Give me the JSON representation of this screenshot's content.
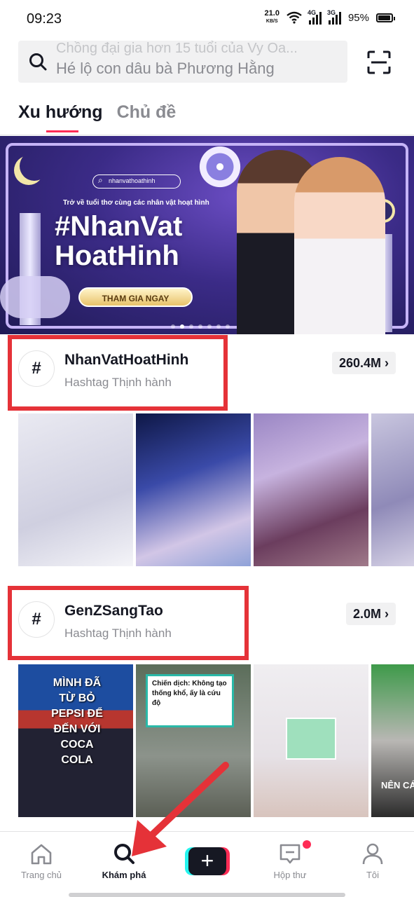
{
  "status_bar": {
    "time": "09:23",
    "net_speed": "21.0",
    "net_unit": "KB/S",
    "sim1": "4G",
    "sim2": "3G",
    "battery": "95%"
  },
  "search": {
    "ghost_suggestion": "Chồng đại gia hơn 15 tuổi của Vy Oa...",
    "placeholder": "Hé lộ con dâu bà Phương Hằng"
  },
  "tabs": [
    {
      "label": "Xu hướng",
      "active": true
    },
    {
      "label": "Chủ đề",
      "active": false
    }
  ],
  "banner": {
    "search_tag": "nhanvathoathinh",
    "subtitle": "Trở về tuổi thơ cùng các nhân vật hoạt hình",
    "title_line1": "#NhanVat",
    "title_line2": "HoatHinh",
    "cta": "THAM GIA NGAY",
    "page_count": 7,
    "current_page": 2
  },
  "hashtags": [
    {
      "name": "NhanVatHoatHinh",
      "subtitle": "Hashtag Thịnh hành",
      "count": "260.4M",
      "thumbnails": [
        "t1a",
        "t1b",
        "t1c",
        "t1d"
      ]
    },
    {
      "name": "GenZSangTao",
      "subtitle": "Hashtag Thịnh hành",
      "count": "2.0M",
      "thumbnails": [
        "t2a",
        "t2b",
        "t2c",
        "t2d"
      ],
      "thumb_texts": {
        "pepsi": "MÌNH ĐÃ TỪ BỎ PEPSI ĐỂ ĐẾN VỚI COCA COLA",
        "campaign": "Chiến dịch: Không tạo thống khổ, ấy là cứu độ",
        "partial": "NÊN CÁ PHÁ"
      }
    }
  ],
  "bottom_nav": [
    {
      "label": "Trang chủ",
      "icon": "home-icon",
      "active": false
    },
    {
      "label": "Khám phá",
      "icon": "search-icon",
      "active": true
    },
    {
      "label": "",
      "icon": "create-plus-icon",
      "active": false
    },
    {
      "label": "Hộp thư",
      "icon": "inbox-icon",
      "active": false,
      "badge": true
    },
    {
      "label": "Tôi",
      "icon": "profile-icon",
      "active": false
    }
  ],
  "colors": {
    "accent": "#fe2c55",
    "annotation": "#e53238",
    "text": "#161823",
    "muted": "#8a8b91"
  }
}
